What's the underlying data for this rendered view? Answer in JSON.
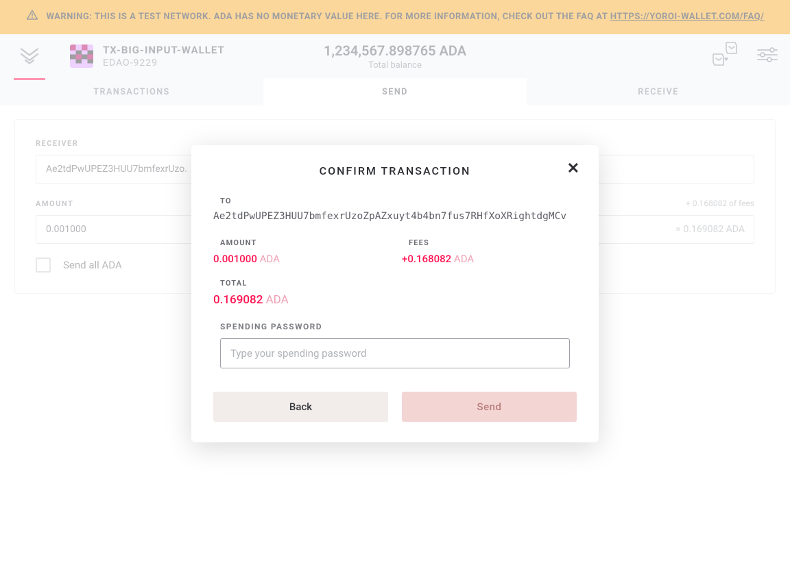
{
  "warning": {
    "prefix": "WARNING: THIS IS A TEST NETWORK. ADA HAS NO MONETARY VALUE HERE. FOR MORE INFORMATION, CHECK OUT THE FAQ AT ",
    "link": "HTTPS://YOROI-WALLET.COM/FAQ/"
  },
  "header": {
    "wallet_name": "TX-BIG-INPUT-WALLET",
    "wallet_plate": "EDAO-9229",
    "balance": "1,234,567.898765 ADA",
    "balance_label": "Total balance"
  },
  "tabs": {
    "transactions": "TRANSACTIONS",
    "send": "SEND",
    "receive": "RECEIVE"
  },
  "form": {
    "receiver_label": "RECEIVER",
    "receiver_value": "Ae2tdPwUPEZ3HUU7bmfexrUzo.",
    "amount_label": "AMOUNT",
    "amount_value": "0.001000",
    "fees_hint": "+ 0.168082 of fees",
    "amount_suffix": "= 0.169082 ADA",
    "send_all_label": "Send all ADA"
  },
  "modal": {
    "title": "CONFIRM TRANSACTION",
    "to_label": "TO",
    "to_address": "Ae2tdPwUPEZ3HUU7bmfexrUzoZpAZxuyt4b4bn7fus7RHfXoXRightdgMCv",
    "amount_label": "AMOUNT",
    "amount_value": "0.001000",
    "amount_currency": "ADA",
    "fees_label": "FEES",
    "fees_value": "+0.168082",
    "fees_currency": "ADA",
    "total_label": "TOTAL",
    "total_value": "0.169082",
    "total_currency": "ADA",
    "pwd_label": "SPENDING PASSWORD",
    "pwd_placeholder": "Type your spending password",
    "back_label": "Back",
    "send_label": "Send"
  }
}
